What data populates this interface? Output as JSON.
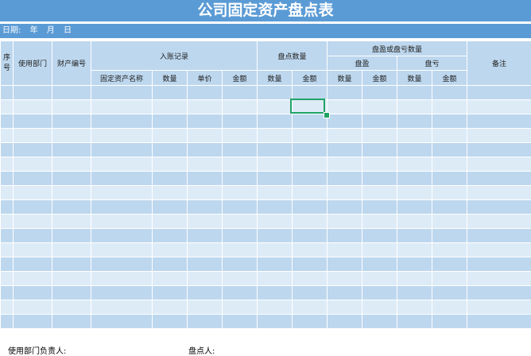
{
  "title": "公司固定资产盘点表",
  "date": {
    "label": "日期:",
    "year": "年",
    "month": "月",
    "day": "日"
  },
  "headers": {
    "seq": "序号",
    "dept": "使用部门",
    "asset_no": "财产编号",
    "book_record": "入账记录",
    "count_qty": "盘点数量",
    "surplus_loss_qty": "盘盈或盘亏数量",
    "surplus": "盘盈",
    "loss": "盘亏",
    "remarks": "备注",
    "asset_name": "固定资产名称",
    "quantity": "数量",
    "unit_price": "单价",
    "amount": "金额"
  },
  "footer": {
    "dept_head": "使用部门负责人:",
    "counter": "盘点人:"
  },
  "colors": {
    "title_bg": "#5b9bd5",
    "header_bg": "#bdd7ee",
    "row_light": "#ddebf7",
    "row_dark": "#bdd7ee",
    "selection": "#21a366"
  }
}
